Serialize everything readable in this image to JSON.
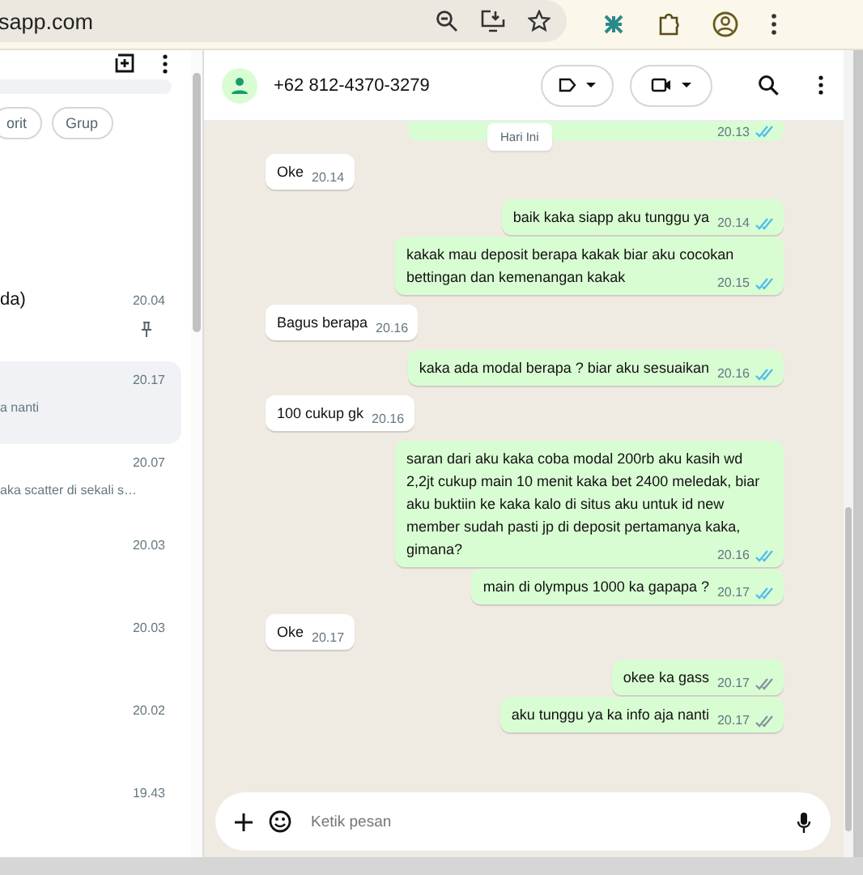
{
  "browser": {
    "url": "sapp.com"
  },
  "sidebar": {
    "filters": [
      {
        "label": "orit",
        "selected": false
      },
      {
        "label": "Grup",
        "selected": false
      }
    ],
    "chats": [
      {
        "title": "da)",
        "time": "20.04",
        "pinned": true,
        "selected": false
      },
      {
        "preview": "a nanti",
        "time": "20.17",
        "pinned": false,
        "selected": true
      },
      {
        "preview": "aka scatter di sekali s…",
        "time": "20.07",
        "pinned": false,
        "selected": false
      },
      {
        "time": "20.03",
        "pinned": false,
        "selected": false
      },
      {
        "time": "20.03",
        "pinned": false,
        "selected": false
      },
      {
        "time": "20.02",
        "pinned": false,
        "selected": false
      },
      {
        "time": "19.43",
        "pinned": false,
        "selected": false
      }
    ]
  },
  "chat": {
    "contact": "+62 812-4370-3279",
    "date_chip": "Hari Ini",
    "clipped_message": {
      "time": "20.13",
      "read": true
    },
    "messages": [
      {
        "kind": "in",
        "text": "Oke",
        "time": "20.14"
      },
      {
        "kind": "out",
        "text": "baik kaka siapp aku tunggu ya",
        "time": "20.14",
        "read": true
      },
      {
        "kind": "out",
        "text": "kakak mau deposit berapa kakak biar aku cocokan bettingan dan kemenangan kakak",
        "time": "20.15",
        "read": true
      },
      {
        "kind": "in",
        "text": "Bagus berapa",
        "time": "20.16"
      },
      {
        "kind": "out",
        "text": "kaka ada modal berapa ? biar aku sesuaikan",
        "time": "20.16",
        "read": true
      },
      {
        "kind": "in",
        "text": "100 cukup gk",
        "time": "20.16"
      },
      {
        "kind": "out",
        "text": "saran dari aku kaka coba modal 200rb aku kasih wd 2,2jt cukup main 10 menit kaka bet 2400 meledak, biar aku buktiin ke kaka kalo di situs aku untuk id new member sudah pasti jp di deposit pertamanya kaka, gimana?",
        "time": "20.16",
        "read": true
      },
      {
        "kind": "out",
        "text": "main di olympus 1000 ka gapapa ?",
        "time": "20.17",
        "read": true
      },
      {
        "kind": "in",
        "text": "Oke",
        "time": "20.17"
      },
      {
        "kind": "out",
        "text": "okee ka gass",
        "time": "20.17",
        "read": false
      },
      {
        "kind": "out",
        "text": "aku tunggu ya ka info aja nanti",
        "time": "20.17",
        "read": false
      }
    ],
    "composer": {
      "placeholder": "Ketik pesan"
    }
  }
}
